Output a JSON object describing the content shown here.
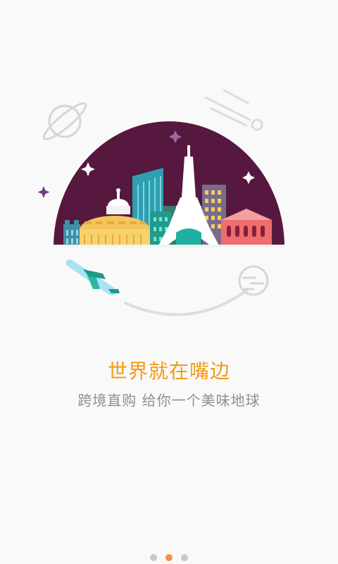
{
  "onboarding": {
    "headline": "世界就在嘴边",
    "subtitle": "跨境直购 给你一个美味地球",
    "page_indicator": {
      "total": 3,
      "current": 2
    }
  },
  "colors": {
    "headline": "#f39a12",
    "subtitle": "#8f8f8f",
    "dome": "#56183f",
    "indicator_active": "#f0914b",
    "indicator_inactive": "#c9c9c9"
  }
}
